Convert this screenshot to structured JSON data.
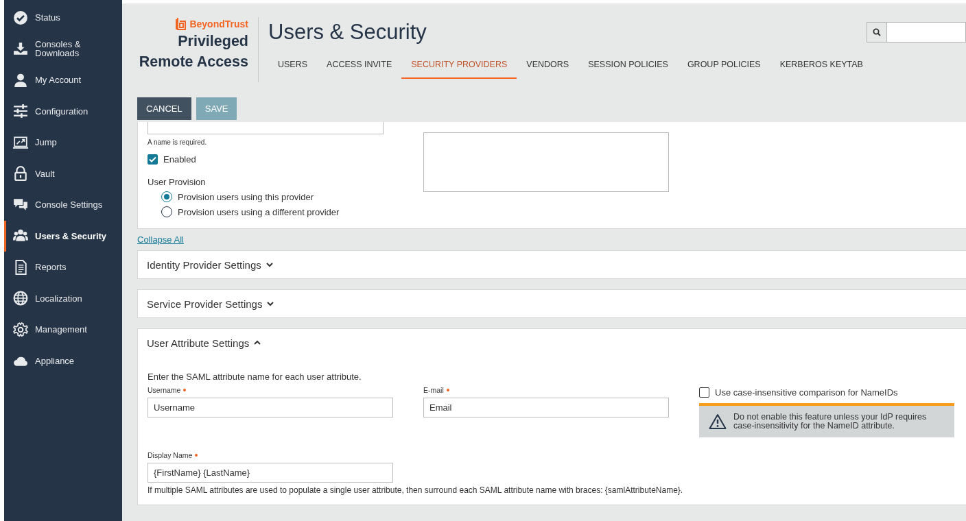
{
  "sidebar": {
    "items": [
      {
        "label": "Status",
        "selected": false
      },
      {
        "label": "Consoles & Downloads",
        "selected": false
      },
      {
        "label": "My Account",
        "selected": false
      },
      {
        "label": "Configuration",
        "selected": false
      },
      {
        "label": "Jump",
        "selected": false
      },
      {
        "label": "Vault",
        "selected": false
      },
      {
        "label": "Console Settings",
        "selected": false
      },
      {
        "label": "Users & Security",
        "selected": true
      },
      {
        "label": "Reports",
        "selected": false
      },
      {
        "label": "Localization",
        "selected": false
      },
      {
        "label": "Management",
        "selected": false
      },
      {
        "label": "Appliance",
        "selected": false
      }
    ]
  },
  "brand": {
    "company": "BeyondTrust",
    "product_line_1": "Privileged",
    "product_line_2": "Remote Access"
  },
  "page_title": "Users & Security",
  "tabs": [
    {
      "label": "USERS",
      "selected": false
    },
    {
      "label": "ACCESS INVITE",
      "selected": false
    },
    {
      "label": "SECURITY PROVIDERS",
      "selected": true
    },
    {
      "label": "VENDORS",
      "selected": false
    },
    {
      "label": "SESSION POLICIES",
      "selected": false
    },
    {
      "label": "GROUP POLICIES",
      "selected": false
    },
    {
      "label": "KERBEROS KEYTAB",
      "selected": false
    }
  ],
  "buttons": [
    {
      "label": "CANCEL",
      "disabled": false
    },
    {
      "label": "SAVE",
      "disabled": true
    }
  ],
  "form": {
    "name_hint": "A name is required.",
    "enabled": {
      "label": "Enabled",
      "checked": true
    },
    "user_provision": {
      "label": "User Provision",
      "options": [
        {
          "label": "Provision users using this provider",
          "selected": true
        },
        {
          "label": "Provision users using a different provider",
          "selected": false
        }
      ]
    }
  },
  "collapse_link": "Collapse All",
  "sections": [
    {
      "title": "Identity Provider Settings",
      "expanded": false
    },
    {
      "title": "Service Provider Settings",
      "expanded": false
    },
    {
      "title": "User Attribute Settings",
      "expanded": true
    }
  ],
  "user_attributes": {
    "intro": "Enter the SAML attribute name for each user attribute.",
    "fields": [
      {
        "label": "Username",
        "required": true,
        "value": "Username"
      },
      {
        "label": "E-mail",
        "required": true,
        "value": "Email"
      },
      {
        "label": "Display Name",
        "required": true,
        "value": "{FirstName} {LastName}"
      }
    ],
    "case_insensitive": {
      "label": "Use case-insensitive comparison for NameIDs",
      "checked": false
    },
    "warning": "Do not enable this feature unless your IdP requires case-insensitivity for the NameID attribute.",
    "help": "If multiple SAML attributes are used to populate a single user attribute, then surround each SAML attribute name with braces: {samlAttributeName}."
  }
}
